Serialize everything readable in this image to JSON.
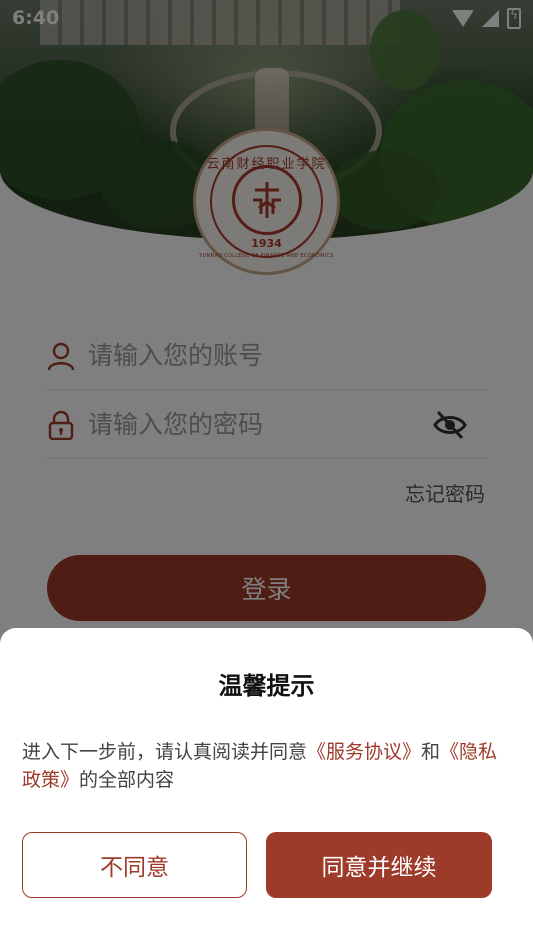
{
  "status_bar": {
    "time": "6:40"
  },
  "emblem": {
    "name_cn": "云南财经职业学院",
    "name_en": "YUNNAN COLLEGE OF FINANCE AND ECONOMICS",
    "year": "1934"
  },
  "login_form": {
    "account_placeholder": "请输入您的账号",
    "password_placeholder": "请输入您的密码",
    "forgot_password": "忘记密码",
    "login_button": "登录"
  },
  "dialog": {
    "title": "温馨提示",
    "body_prefix": "进入下一步前，请认真阅读并同意",
    "service_link": "《服务协议》",
    "and": "和",
    "privacy_link": "《隐私政策》",
    "body_suffix": "的全部内容",
    "disagree_button": "不同意",
    "agree_button": "同意并继续"
  },
  "colors": {
    "accent": "#9e3a29",
    "overlay": "rgba(0,0,0,0.5)"
  }
}
